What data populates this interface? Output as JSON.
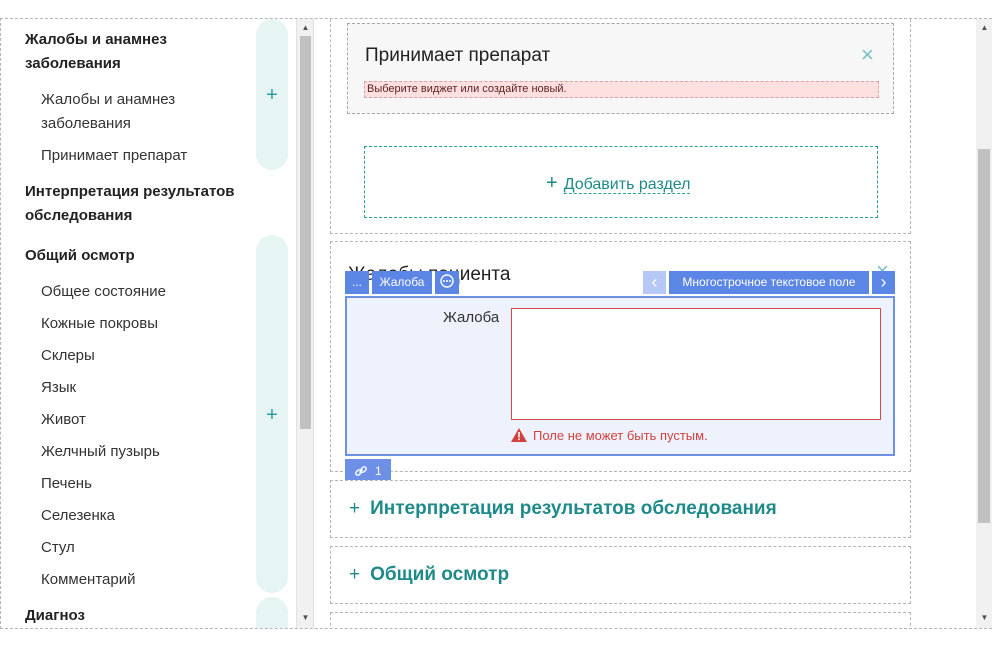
{
  "outline": {
    "sections": [
      {
        "label": "Жалобы и анамнез заболевания",
        "items": [
          "Жалобы и анамнез заболевания",
          "Принимает препарат"
        ]
      },
      {
        "label": "Интерпретация результатов обследования",
        "items": []
      },
      {
        "label": "Общий осмотр",
        "items": [
          "Общее состояние",
          "Кожные покровы",
          "Склеры",
          "Язык",
          "Живот",
          "Желчный пузырь",
          "Печень",
          "Селезенка",
          "Стул",
          "Комментарий"
        ]
      },
      {
        "label": "Диагноз",
        "items": []
      }
    ],
    "add_icon": "+"
  },
  "main": {
    "widget_card": {
      "title": "Принимает препарат",
      "close_icon": "×",
      "error": "Выберите виджет или создайте новый."
    },
    "add_section": {
      "plus": "+",
      "label": "Добавить раздел"
    },
    "complaints_section": {
      "title": "Жалобы пациента",
      "close_icon": "×"
    },
    "toolbar": {
      "more": "...",
      "field_name": "Жалоба",
      "options_icon": "⊙",
      "prev_icon": "‹",
      "widget_type": "Многострочное текстовое поле",
      "next_icon": "›"
    },
    "field": {
      "label": "Жалоба",
      "value": "",
      "error": "Поле не может быть пустым."
    },
    "link_tag": {
      "count": "1"
    },
    "collapsed_sections": [
      {
        "plus": "+",
        "label": "Интерпретация результатов обследования"
      },
      {
        "plus": "+",
        "label": "Общий осмотр"
      }
    ]
  },
  "colors": {
    "accent": "#2a9d9d",
    "editor_blue": "#5b86e5",
    "error": "#d0423d"
  }
}
